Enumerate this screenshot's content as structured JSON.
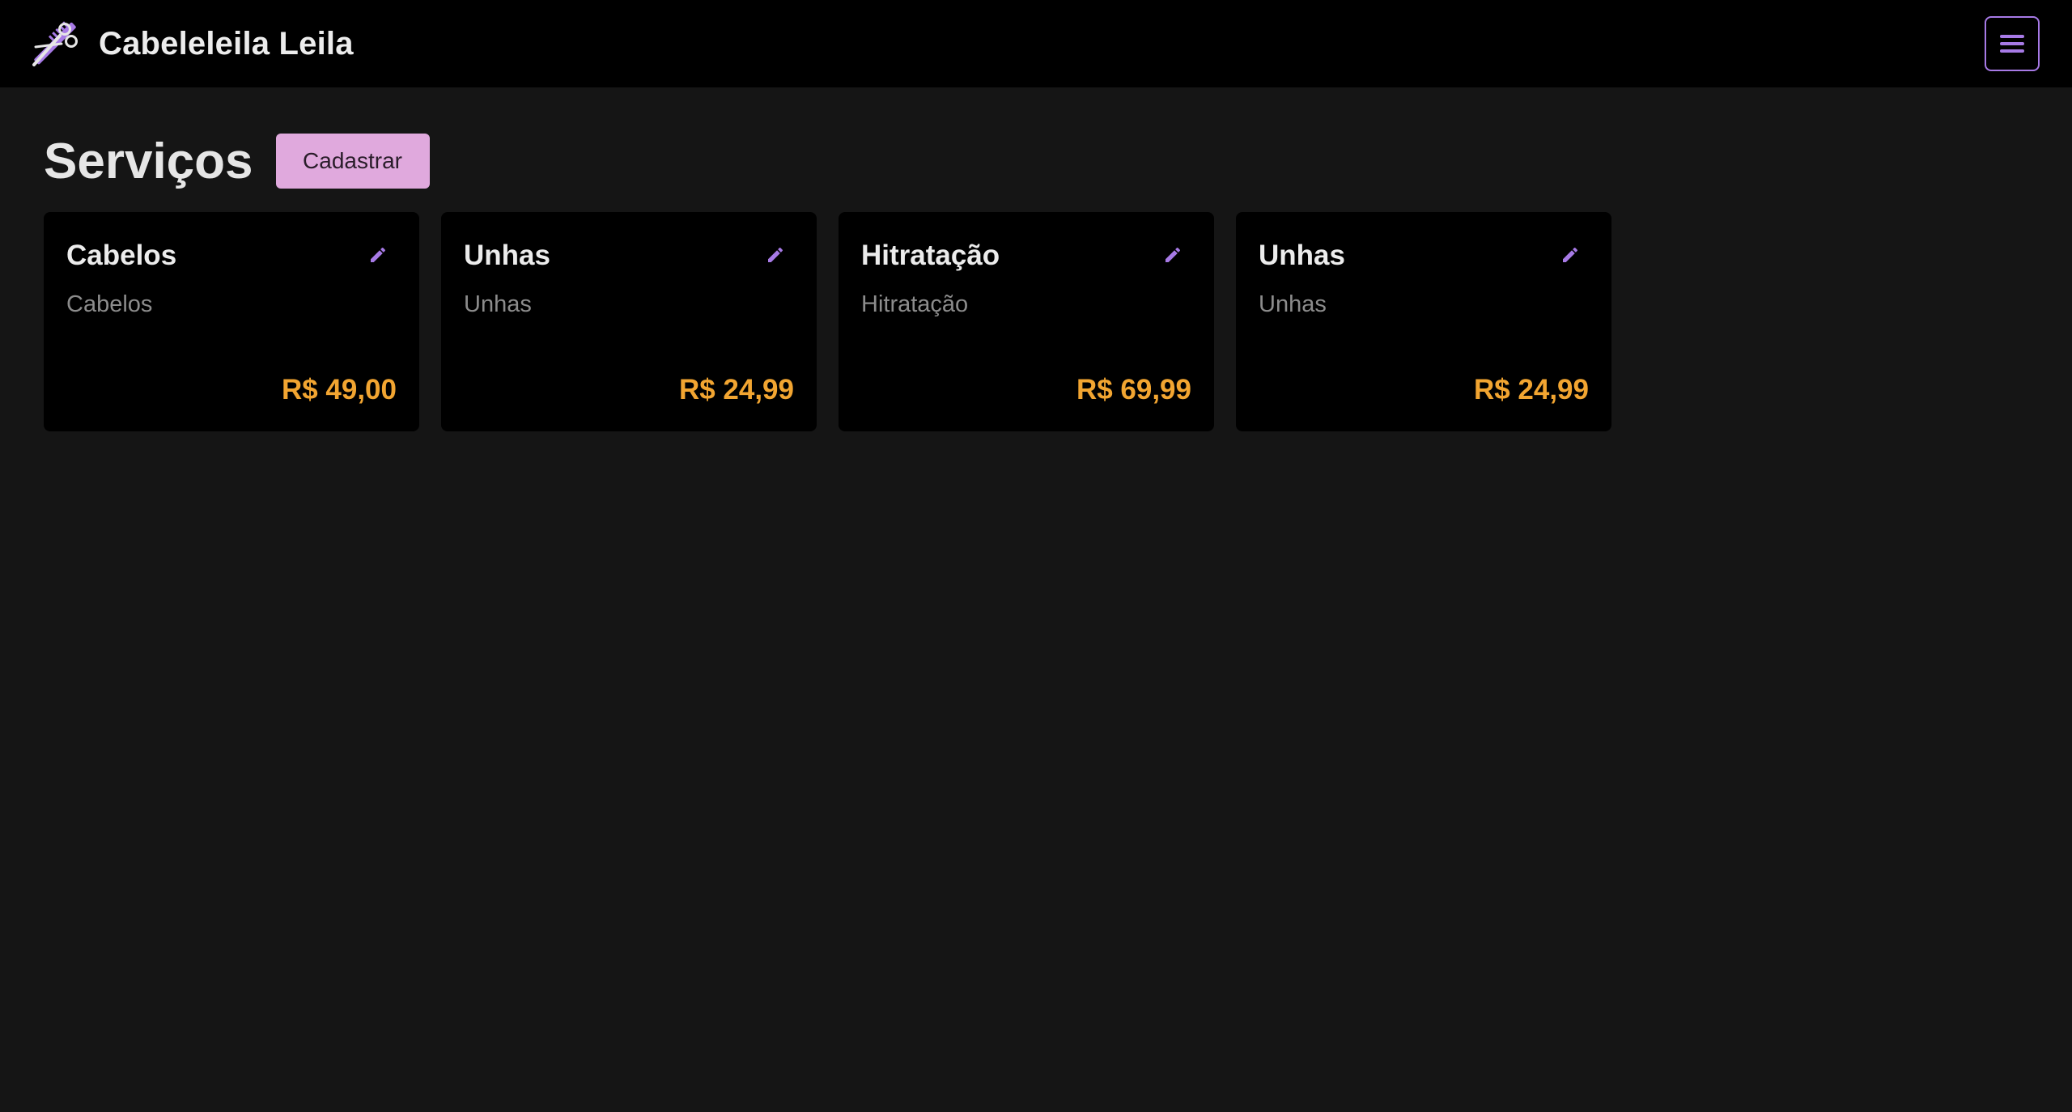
{
  "brand": {
    "name": "Cabeleleila Leila",
    "logo_icon": "scissors-comb-icon"
  },
  "navbar": {
    "menu_icon": "hamburger-menu-icon"
  },
  "page": {
    "title": "Serviços",
    "register_label": "Cadastrar"
  },
  "services": [
    {
      "title": "Cabelos",
      "description": "Cabelos",
      "price": "R$ 49,00"
    },
    {
      "title": "Unhas",
      "description": "Unhas",
      "price": "R$ 24,99"
    },
    {
      "title": "Hitratação",
      "description": "Hitratação",
      "price": "R$ 69,99"
    },
    {
      "title": "Unhas",
      "description": "Unhas",
      "price": "R$ 24,99"
    }
  ],
  "colors": {
    "accent_purple": "#a77ae6",
    "button_pink": "#e0a9dd",
    "price_orange": "#f2a531",
    "navbar_bg": "#000000",
    "page_bg": "#151515",
    "card_bg": "#000000"
  },
  "icons": {
    "edit": "pencil-icon"
  }
}
